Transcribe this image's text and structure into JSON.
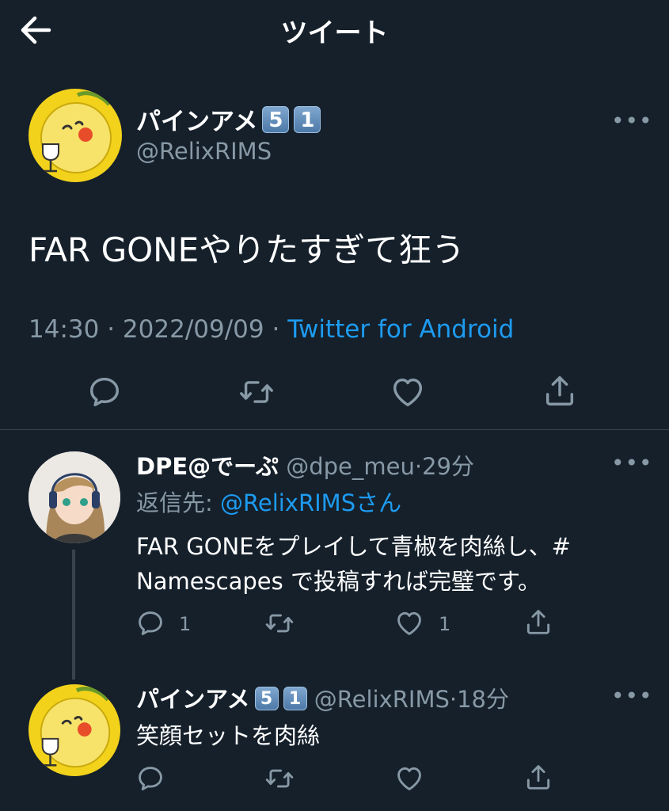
{
  "header": {
    "title": "ツイート"
  },
  "main_tweet": {
    "display_name": "パインアメ",
    "badges": [
      "5",
      "1"
    ],
    "handle": "@RelixRIMS",
    "text": "FAR GONEやりたすぎて狂う",
    "time": "14:30",
    "separator": "·",
    "date": "2022/09/09",
    "source": "Twitter for Android"
  },
  "replies": [
    {
      "display_name": "DPE@でーぷ",
      "handle": "@dpe_meu",
      "separator": "·",
      "time_ago": "29分",
      "reply_to_label": "返信先:",
      "reply_to_handle": "@RelixRIMS",
      "reply_to_suffix": "さん",
      "text_line1": "FAR GONEをプレイして青椒を肉絲し、#",
      "text_line2": "Namescapes で投稿すれば完璧です。",
      "reply_count": "1",
      "like_count": "1"
    },
    {
      "display_name": "パインアメ",
      "badges": [
        "5",
        "1"
      ],
      "handle": "@RelixRIMS",
      "separator": "·",
      "time_ago": "18分",
      "text": "笑顔セットを肉絲"
    }
  ],
  "more_glyph": "•••",
  "icons": [
    "back-arrow-icon",
    "more-icon",
    "reply-icon",
    "retweet-icon",
    "like-icon",
    "share-icon"
  ],
  "colors": {
    "background": "#15202b",
    "text": "#ffffff",
    "muted": "#8899a6",
    "link": "#1d9bf0",
    "divider": "#38444d",
    "avatar_yellow": "#f2d21b"
  }
}
